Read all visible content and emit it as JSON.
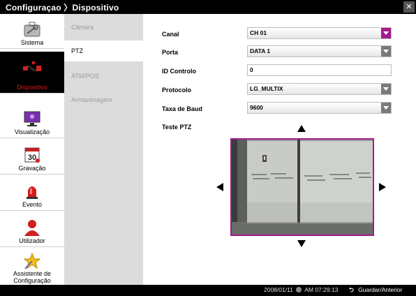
{
  "window": {
    "title": "Configuraçao 〉Dispositivo",
    "close_label": "✕"
  },
  "sidebar": {
    "items": [
      {
        "label": "Sistema",
        "icon": "toolbox-icon"
      },
      {
        "label": "Dispositivo",
        "icon": "cable-plug-icon",
        "active": true
      },
      {
        "label": "Visualização",
        "icon": "monitor-icon"
      },
      {
        "label": "Gravação",
        "icon": "calendar-30-icon"
      },
      {
        "label": "Evento",
        "icon": "alarm-light-icon"
      },
      {
        "label": "Utilizador",
        "icon": "user-icon"
      },
      {
        "label": "Assistente de\nConfiguração",
        "icon": "wizard-star-icon"
      }
    ]
  },
  "subnav": {
    "items": [
      {
        "label": "Câmara"
      },
      {
        "label": "PTZ",
        "active": true
      },
      {
        "label": "ATM/POS"
      },
      {
        "label": "Armazenagem"
      }
    ]
  },
  "form": {
    "canal_label": "Canal",
    "canal_value": "CH 01",
    "porta_label": "Porta",
    "porta_value": "DATA 1",
    "id_label": "ID Controlo",
    "id_value": "0",
    "protocolo_label": "Protocolo",
    "protocolo_value": "LG_MULTIX",
    "baud_label": "Taxa de Baud",
    "baud_value": "9600",
    "teste_label": "Teste PTZ"
  },
  "colors": {
    "accent": "#a21a8c",
    "active_red": "#cc1f1f"
  },
  "statusbar": {
    "date": "2008/01/11",
    "time": "AM 07:29:13",
    "back_label": "Guardar/Anterior"
  }
}
